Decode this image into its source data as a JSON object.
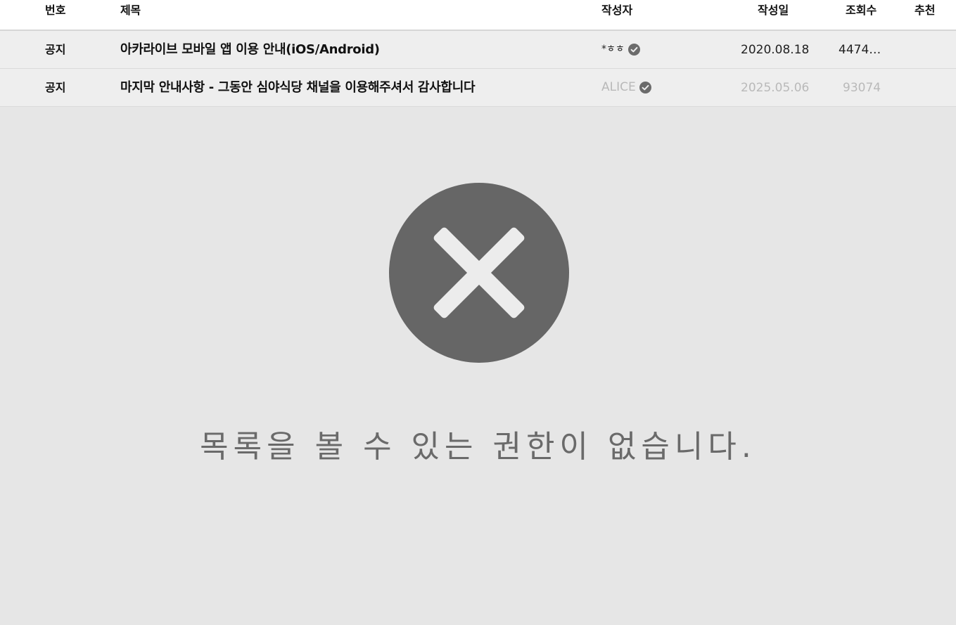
{
  "table": {
    "headers": {
      "number": "번호",
      "title": "제목",
      "author": "작성자",
      "date": "작성일",
      "views": "조회수",
      "recommend": "추천"
    },
    "rows": [
      {
        "number": "공지",
        "title": "아카라이브 모바일 앱 이용 안내(iOS/Android)",
        "author": "*ㅎㅎ",
        "author_verified": true,
        "date": "2020.08.18",
        "views": "4474…",
        "recommend": ""
      },
      {
        "number": "공지",
        "title": "마지막 안내사항 - 그동안 심야식당 채널을 이용해주셔서 감사합니다",
        "author": "ALICE",
        "author_verified": true,
        "date": "2025.05.06",
        "views": "93074",
        "recommend": ""
      }
    ]
  },
  "error": {
    "icon": "close-circle-icon",
    "message": "목록을 볼 수 있는 권한이 없습니다."
  },
  "colors": {
    "background": "#e6e6e6",
    "row_background": "#eeeeee",
    "icon_fill": "#666666",
    "muted_text": "#b9b9b9"
  }
}
